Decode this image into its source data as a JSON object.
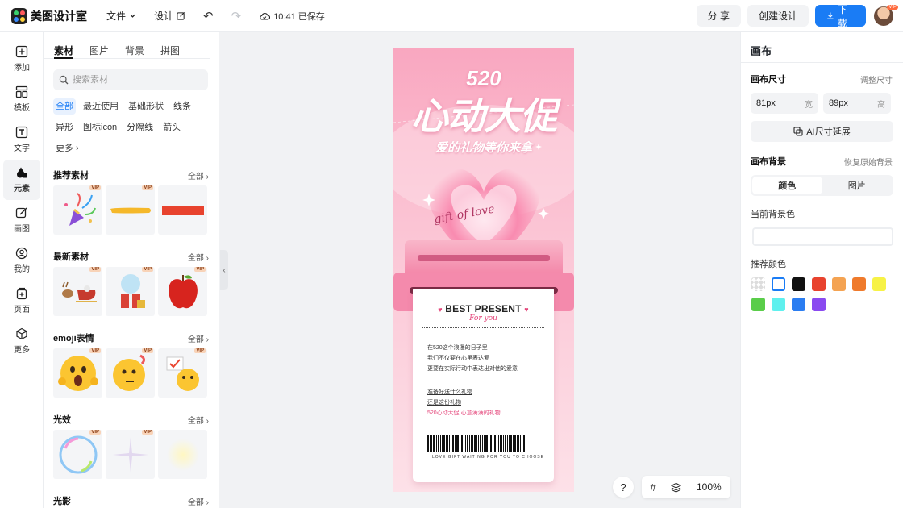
{
  "app": {
    "name": "美图设计室"
  },
  "topbar": {
    "file_label": "文件",
    "design_label": "设计",
    "save_time": "10:41 已保存",
    "share_label": "分 享",
    "create_label": "创建设计",
    "download_label": "下载",
    "avatar_badge": "VIP"
  },
  "rail": {
    "items": [
      {
        "label": "添加",
        "icon": "plus-square-icon"
      },
      {
        "label": "模板",
        "icon": "template-icon"
      },
      {
        "label": "文字",
        "icon": "text-icon"
      },
      {
        "label": "元素",
        "icon": "shapes-icon"
      },
      {
        "label": "画图",
        "icon": "draw-icon"
      },
      {
        "label": "我的",
        "icon": "user-icon"
      },
      {
        "label": "页面",
        "icon": "page-add-icon"
      },
      {
        "label": "更多",
        "icon": "cube-icon"
      }
    ]
  },
  "panel": {
    "tabs": [
      "素材",
      "图片",
      "背景",
      "拼图"
    ],
    "search_placeholder": "搜索素材",
    "chips": [
      "全部",
      "最近使用",
      "基础形状",
      "线条",
      "异形",
      "图标icon",
      "分隔线",
      "箭头",
      "更多 ›"
    ],
    "all_label": "全部",
    "vip": "VIP",
    "sections": [
      {
        "title": "推荐素材"
      },
      {
        "title": "最新素材"
      },
      {
        "title": "emoji表情"
      },
      {
        "title": "光效"
      },
      {
        "title": "光影"
      }
    ]
  },
  "poster": {
    "number": "520",
    "title": "心动大促",
    "subtitle": "爱的礼物等你来拿",
    "script": "gift of love",
    "receipt_title": "BEST PRESENT",
    "receipt_script": "For you",
    "lines1": [
      "在520这个浪漫的日子里",
      "我们不仅要在心里表达爱",
      "更要在实际行动中表达出对他的爱意"
    ],
    "lines2": [
      "准备好送什么礼物",
      "还是这份礼物",
      "520心动大促 心意满满的礼物"
    ],
    "footer": "LOVE GIFT WAITING FOR YOU TO CHOOSE"
  },
  "canvas_controls": {
    "help": "?",
    "zoom": "100%"
  },
  "right": {
    "title": "画布",
    "size_label": "画布尺寸",
    "adjust_label": "调整尺寸",
    "width_value": "81px",
    "width_unit": "宽",
    "height_value": "89px",
    "height_unit": "高",
    "ai_label": "AI尺寸延展",
    "bg_label": "画布背景",
    "restore_label": "恢复原始背景",
    "seg_color": "颜色",
    "seg_image": "图片",
    "current_bg_label": "当前背景色",
    "recommend_label": "推荐颜色",
    "swatches": [
      "transparent",
      "#ffffff",
      "#111111",
      "#e8432e",
      "#f4a352",
      "#ef7a2c",
      "#f7f246",
      "#5acd4a",
      "#5ff0ee",
      "#2b7df1",
      "#8a4af0"
    ]
  }
}
